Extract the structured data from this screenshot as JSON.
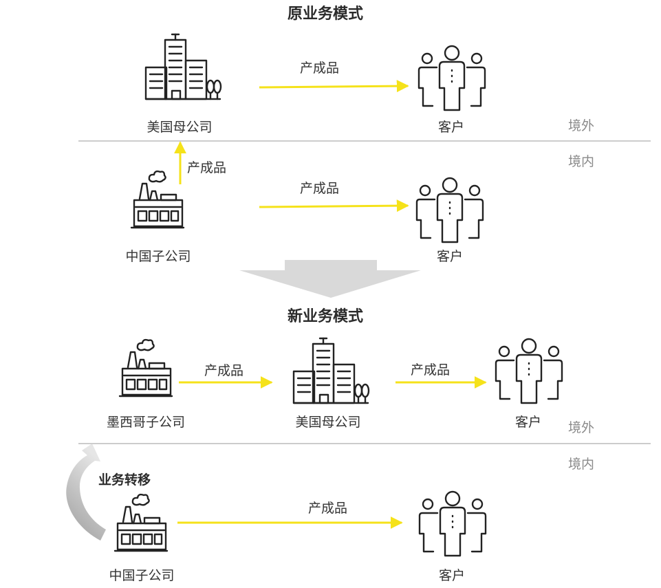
{
  "diagram": {
    "original_model": {
      "title": "原业务模式",
      "us_parent_label": "美国母公司",
      "customer_top_label": "客户",
      "china_sub_label": "中国子公司",
      "customer_bottom_label": "客户",
      "flow_us_to_customer": "产成品",
      "flow_cn_to_us": "产成品",
      "flow_cn_to_customer": "产成品",
      "region_overseas": "境外",
      "region_domestic": "境内"
    },
    "new_model": {
      "title": "新业务模式",
      "mexico_sub_label": "墨西哥子公司",
      "us_parent_label": "美国母公司",
      "customer_top_label": "客户",
      "china_sub_label": "中国子公司",
      "customer_bottom_label": "客户",
      "flow_mx_to_us": "产成品",
      "flow_us_to_customer": "产成品",
      "flow_cn_to_customer": "产成品",
      "transfer_label": "业务转移",
      "region_overseas": "境外",
      "region_domestic": "境内"
    },
    "colors": {
      "arrow": "#f5e21a",
      "transition_arrow": "#d9d9d9",
      "transfer_arrow": "#c8c8c8",
      "divider": "#9a9a9a",
      "region_text": "#8a8a8a",
      "icon_stroke": "#222222"
    },
    "icons": {
      "parent_company": "office-building-icon",
      "subsidiary": "factory-icon",
      "customer": "customer-group-icon"
    }
  }
}
